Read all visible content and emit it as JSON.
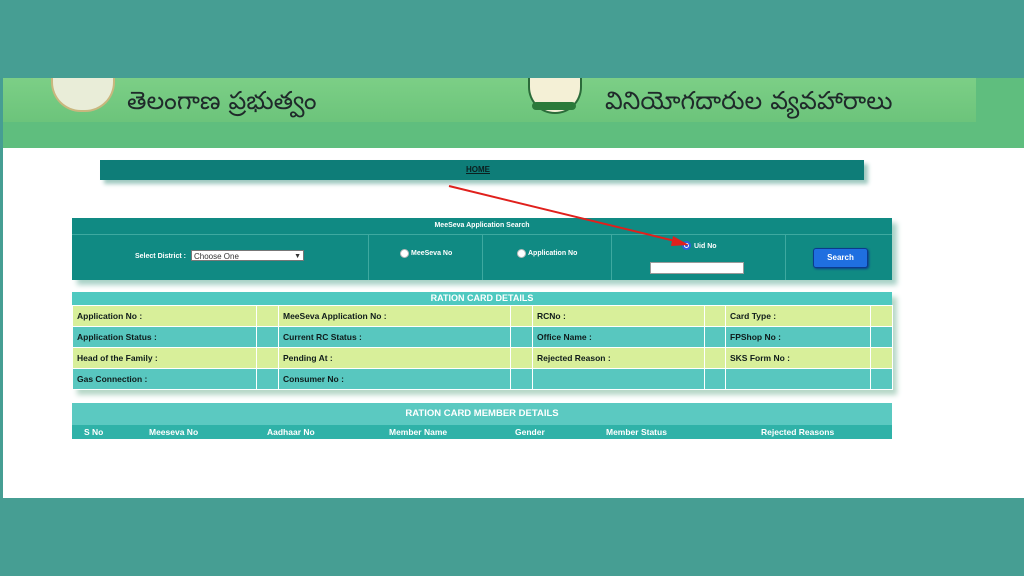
{
  "banner": {
    "left_title": "తెలంగాణ ప్రభుత్వం",
    "right_title": "వినియోగదారుల వ్యవహారాలు"
  },
  "nav": {
    "home_label": "HOME"
  },
  "search": {
    "title": "MeeSeva Application Search",
    "district_label": "Select District :",
    "district_value": "Choose One",
    "radio_meeseva": "MeeSeva No",
    "radio_application": "Application No",
    "radio_uid": "Uid No",
    "selected": "Uid No",
    "uid_value": "",
    "search_button": "Search"
  },
  "details": {
    "title": "RATION CARD DETAILS",
    "rows": [
      [
        "Application No :",
        "",
        "MeeSeva Application No :",
        "",
        "RCNo :",
        "",
        "Card Type :",
        ""
      ],
      [
        "Application Status :",
        "",
        "Current RC Status :",
        "",
        "Office Name :",
        "",
        "FPShop No :",
        ""
      ],
      [
        "Head of the Family :",
        "",
        "Pending At :",
        "",
        "Rejected Reason :",
        "",
        "SKS Form No :",
        ""
      ],
      [
        "Gas Connection :",
        "",
        "Consumer No :",
        "",
        "",
        "",
        "",
        ""
      ]
    ]
  },
  "members": {
    "title": "RATION CARD MEMBER DETAILS",
    "columns": [
      "S No",
      "Meeseva No",
      "Aadhaar No",
      "Member Name",
      "Gender",
      "Member Status",
      "Rejected Reasons"
    ]
  },
  "colors": {
    "frame": "#469e93",
    "panel": "#108a83",
    "row_lime": "#d8ef9a",
    "row_teal": "#58c7bf",
    "button": "#1f6fe0",
    "arrow": "#e0201c"
  }
}
